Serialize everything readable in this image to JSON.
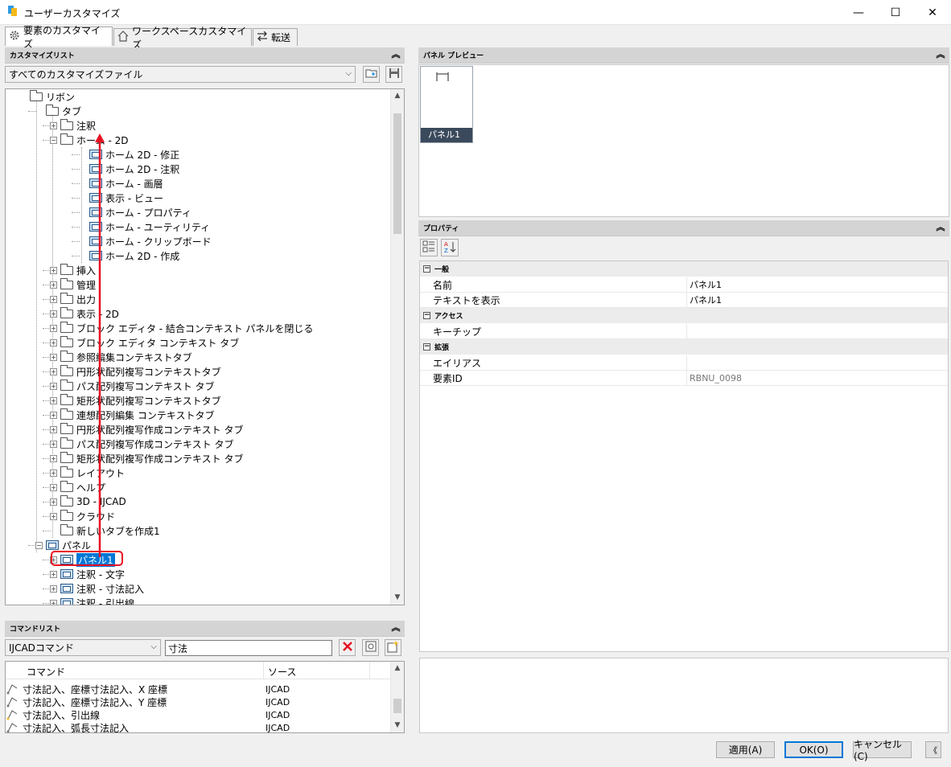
{
  "window": {
    "title": "ユーザーカスタマイズ",
    "min": "—",
    "max": "☐",
    "close": "✕"
  },
  "tabs": [
    {
      "label": "要素のカスタマイズ"
    },
    {
      "label": "ワークスペースカスタマイズ"
    },
    {
      "label": "転送"
    }
  ],
  "custom_list": {
    "header": "カスタマイズリスト",
    "collapse": "︽",
    "file_combo": "すべてのカスタマイズファイル",
    "tree": [
      {
        "indent": 0,
        "type": "folder-open",
        "label": "リボン"
      },
      {
        "indent": 1,
        "type": "folder-open",
        "label": "タブ"
      },
      {
        "indent": 2,
        "type": "folder",
        "expander": "+",
        "label": "注釈"
      },
      {
        "indent": 2,
        "type": "folder-open",
        "expander": "-",
        "label": "ホーム - 2D"
      },
      {
        "indent": 3,
        "type": "panel",
        "label": "ホーム 2D - 修正"
      },
      {
        "indent": 3,
        "type": "panel",
        "label": "ホーム 2D - 注釈"
      },
      {
        "indent": 3,
        "type": "panel",
        "label": "ホーム - 画層"
      },
      {
        "indent": 3,
        "type": "panel",
        "label": "表示 - ビュー"
      },
      {
        "indent": 3,
        "type": "panel",
        "label": "ホーム - プロパティ"
      },
      {
        "indent": 3,
        "type": "panel",
        "label": "ホーム - ユーティリティ"
      },
      {
        "indent": 3,
        "type": "panel",
        "label": "ホーム - クリップボード"
      },
      {
        "indent": 3,
        "type": "panel",
        "label": "ホーム 2D - 作成"
      },
      {
        "indent": 2,
        "type": "folder",
        "expander": "+",
        "label": "挿入"
      },
      {
        "indent": 2,
        "type": "folder",
        "expander": "+",
        "label": "管理"
      },
      {
        "indent": 2,
        "type": "folder",
        "expander": "+",
        "label": "出力"
      },
      {
        "indent": 2,
        "type": "folder",
        "expander": "+",
        "label": "表示 - 2D"
      },
      {
        "indent": 2,
        "type": "folder",
        "expander": "+",
        "label": "ブロック エディタ - 結合コンテキスト パネルを閉じる"
      },
      {
        "indent": 2,
        "type": "folder",
        "expander": "+",
        "label": "ブロック エディタ コンテキスト タブ"
      },
      {
        "indent": 2,
        "type": "folder",
        "expander": "+",
        "label": "参照編集コンテキストタブ"
      },
      {
        "indent": 2,
        "type": "folder",
        "expander": "+",
        "label": "円形状配列複写コンテキストタブ"
      },
      {
        "indent": 2,
        "type": "folder",
        "expander": "+",
        "label": "パス配列複写コンテキスト タブ"
      },
      {
        "indent": 2,
        "type": "folder",
        "expander": "+",
        "label": "矩形状配列複写コンテキストタブ"
      },
      {
        "indent": 2,
        "type": "folder",
        "expander": "+",
        "label": "連想配列編集 コンテキストタブ"
      },
      {
        "indent": 2,
        "type": "folder",
        "expander": "+",
        "label": "円形状配列複写作成コンテキスト タブ"
      },
      {
        "indent": 2,
        "type": "folder",
        "expander": "+",
        "label": "パス配列複写作成コンテキスト タブ"
      },
      {
        "indent": 2,
        "type": "folder",
        "expander": "+",
        "label": "矩形状配列複写作成コンテキスト タブ"
      },
      {
        "indent": 2,
        "type": "folder",
        "expander": "+",
        "label": "レイアウト"
      },
      {
        "indent": 2,
        "type": "folder",
        "expander": "+",
        "label": "ヘルプ"
      },
      {
        "indent": 2,
        "type": "folder",
        "expander": "+",
        "label": "3D - IJCAD"
      },
      {
        "indent": 2,
        "type": "folder",
        "expander": "+",
        "label": "クラウド"
      },
      {
        "indent": 2,
        "type": "folder",
        "label": "新しいタブを作成1"
      },
      {
        "indent": 1,
        "type": "panel-open",
        "expander": "-",
        "label": "パネル"
      },
      {
        "indent": 2,
        "type": "panel",
        "expander": "+",
        "label": "パネル1",
        "selected": true
      },
      {
        "indent": 2,
        "type": "panel",
        "expander": "+",
        "label": "注釈 - 文字"
      },
      {
        "indent": 2,
        "type": "panel",
        "expander": "+",
        "label": "注釈 - 寸法記入"
      },
      {
        "indent": 2,
        "type": "panel",
        "expander": "+",
        "label": "注釈 - 引出線"
      }
    ]
  },
  "command_list": {
    "header": "コマンドリスト",
    "collapse": "︽",
    "filter_combo": "IJCADコマンド",
    "search_value": "寸法",
    "columns": [
      "コマンド",
      "ソース"
    ],
    "rows": [
      {
        "command": "寸法記入、座標寸法記入、X 座標",
        "source": "IJCAD"
      },
      {
        "command": "寸法記入、座標寸法記入、Y 座標",
        "source": "IJCAD"
      },
      {
        "command": "寸法記入、引出線",
        "source": "IJCAD"
      },
      {
        "command": "寸法記入、弧長寸法記入",
        "source": "IJCAD"
      }
    ]
  },
  "panel_preview": {
    "header": "パネル プレビュー",
    "collapse": "︽",
    "thumb_label": "パネル1"
  },
  "properties": {
    "header": "プロパティ",
    "collapse": "︽",
    "categories": [
      {
        "name": "一般",
        "toggle": "−",
        "rows": [
          {
            "key": "名前",
            "value": "パネル1"
          },
          {
            "key": "テキストを表示",
            "value": "パネル1"
          }
        ]
      },
      {
        "name": "アクセス",
        "toggle": "−",
        "rows": [
          {
            "key": "キーチップ",
            "value": ""
          }
        ]
      },
      {
        "name": "拡張",
        "toggle": "−",
        "rows": [
          {
            "key": "エイリアス",
            "value": ""
          },
          {
            "key": "要素ID",
            "value": "RBNU_0098"
          }
        ]
      }
    ]
  },
  "footer": {
    "apply": "適用(A)",
    "ok": "OK(O)",
    "cancel": "キャンセル(C)",
    "more": "《"
  },
  "colors": {
    "selection": "#0078d7",
    "annotation": "#e81123"
  }
}
